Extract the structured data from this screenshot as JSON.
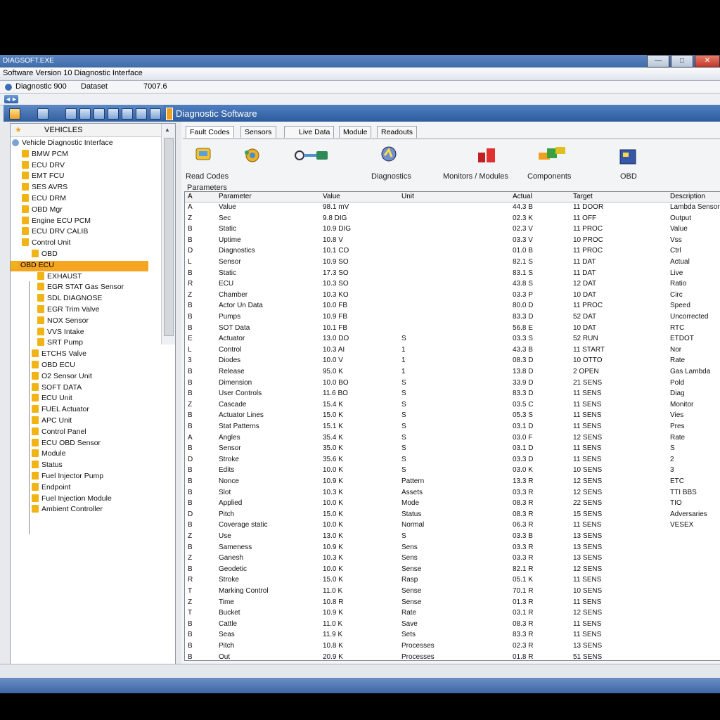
{
  "window": {
    "title": "DIAGSOFT.EXE",
    "window_buttons": [
      "—",
      "□",
      "✕"
    ]
  },
  "menubar": {
    "title": "Software Version 10 Diagnostic Interface",
    "items": [
      "Diagnostic 900",
      "Dataset",
      "7007.6"
    ]
  },
  "header": {
    "title": "Diagnostic Software"
  },
  "left_panel": {
    "header_label": "VEHICLES",
    "tree": [
      "Vehicle Diagnostic Interface",
      "BMW PCM",
      "ECU DRV",
      "EMT FCU",
      "SES AVRS",
      "ECU DRM",
      "OBD Mgr",
      "Engine ECU PCM",
      "ECU DRV CALIB",
      "Control Unit",
      "OBD",
      "OBD ECU",
      "EXHAUST",
      "EGR STAT Gas Sensor",
      "SDL DIAGNOSE",
      "EGR Trim Valve",
      "NOX Sensor",
      "VVS Intake",
      "SRT Pump",
      "ETCHS Valve",
      "OBD ECU",
      "O2 Sensor Unit",
      "SOFT DATA",
      "ECU Unit",
      "FUEL Actuator",
      "APC Unit",
      "Control Panel",
      "ECU OBD Sensor",
      "Module",
      "Status",
      "Fuel Injector Pump",
      "Endpoint",
      "Fuel Injection Module",
      "Ambient Controller"
    ]
  },
  "right_panel": {
    "tabs": [
      "Fault Codes",
      "Sensors",
      "Live Data",
      "Module",
      "Readouts"
    ],
    "tools": [
      {
        "icon": "scan-tool-icon",
        "label": "Read Codes"
      },
      {
        "icon": "gear-tool-icon",
        "label": ""
      },
      {
        "icon": "connector-tool-icon",
        "label": ""
      },
      {
        "icon": "diagnostics-tool-icon",
        "label": "Diagnostics"
      },
      {
        "icon": "chart-tool-icon",
        "label": "Monitors / Modules"
      },
      {
        "icon": "parts-tool-icon",
        "label": "Components"
      },
      {
        "icon": "obd-tool-icon",
        "label": "OBD"
      }
    ],
    "parameters_label": "Parameters",
    "columns": [
      "A",
      "Parameter",
      "Value",
      "Unit",
      "Actual",
      "Target",
      "Description"
    ],
    "rows": [
      [
        "A",
        "Value",
        "98.1 mV",
        "",
        "44.3 B",
        "11 DOOR",
        "Lambda Sensor"
      ],
      [
        "Z",
        "Sec",
        "9.8 DIG",
        "",
        "02.3 K",
        "11 OFF",
        "Output"
      ],
      [
        "B",
        "Static",
        "10.9 DIG",
        "",
        "02.3 V",
        "11 PROC",
        "Value"
      ],
      [
        "B",
        "Uptime",
        "10.8 V",
        "",
        "03.3 V",
        "10 PROC",
        "Vss"
      ],
      [
        "D",
        "Diagnostics",
        "10.1 CO",
        "",
        "01.0 B",
        "11 PROC",
        "Ctrl"
      ],
      [
        "L",
        "Sensor",
        "10.9 SO",
        "",
        "82.1 S",
        "11 DAT",
        "Actual"
      ],
      [
        "B",
        "Static",
        "17.3 SO",
        "",
        "83.1 S",
        "11 DAT",
        "Live"
      ],
      [
        "R",
        "ECU",
        "10.3 SO",
        "",
        "43.8 S",
        "12 DAT",
        "Ratio"
      ],
      [
        "Z",
        "Chamber",
        "10.3 KO",
        "",
        "03.3 P",
        "10 DAT",
        "Circ"
      ],
      [
        "B",
        "Actor Un Data",
        "10.0 FB",
        "",
        "80.0 D",
        "11 PROC",
        "Speed"
      ],
      [
        "B",
        "Pumps",
        "10.9 FB",
        "",
        "83.3 D",
        "52 DAT",
        "Uncorrected"
      ],
      [
        "B",
        "SOT Data",
        "10.1 FB",
        "",
        "56.8 E",
        "10 DAT",
        "RTC"
      ],
      [
        "E",
        "Actuator",
        "13.0 DO",
        "S",
        "03.3 S",
        "52 RUN",
        "ETDOT"
      ],
      [
        "L",
        "Control",
        "10.3 AI",
        "1",
        "43.3 B",
        "11 START",
        "Nor"
      ],
      [
        "3",
        "Diodes",
        "10.0 V",
        "1",
        "08.3 D",
        "10 OTTO",
        "Rate"
      ],
      [
        "B",
        "Release",
        "95.0 K",
        "1",
        "13.8 D",
        "2 OPEN",
        "Gas Lambda"
      ],
      [
        "B",
        "Dimension",
        "10.0 BO",
        "S",
        "33.9 D",
        "21 SENS",
        "Pold"
      ],
      [
        "B",
        "User Controls",
        "11.6 BO",
        "S",
        "83.3 D",
        "11 SENS",
        "Diag"
      ],
      [
        "Z",
        "Cascade",
        "15.4 K",
        "S",
        "03.5 C",
        "11 SENS",
        "Monitor"
      ],
      [
        "B",
        "Actuator Lines",
        "15.0 K",
        "S",
        "05.3 S",
        "11 SENS",
        "Vies"
      ],
      [
        "B",
        "Stat Patterns",
        "15.1 K",
        "S",
        "03.1 D",
        "11 SENS",
        "Pres"
      ],
      [
        "A",
        "Angles",
        "35.4 K",
        "S",
        "03.0 F",
        "12 SENS",
        "Rate"
      ],
      [
        "B",
        "Sensor",
        "35.0 K",
        "S",
        "03.1 D",
        "11 SENS",
        "S"
      ],
      [
        "D",
        "Stroke",
        "35.6 K",
        "S",
        "03.3 D",
        "11 SENS",
        "2"
      ],
      [
        "B",
        "Edits",
        "10.0 K",
        "S",
        "03.0 K",
        "10 SENS",
        "3"
      ],
      [
        "B",
        "Nonce",
        "10.9 K",
        "Pattern",
        "13.3 R",
        "12 SENS",
        "ETC"
      ],
      [
        "B",
        "Slot",
        "10.3 K",
        "Assets",
        "03.3 R",
        "12 SENS",
        "TTI BBS"
      ],
      [
        "B",
        "Applied",
        "10.0 K",
        "Mode",
        "08.3 R",
        "22 SENS",
        "TIO"
      ],
      [
        "D",
        "Pitch",
        "15.0 K",
        "Status",
        "08.3 R",
        "15 SENS",
        "Adversaries"
      ],
      [
        "B",
        "Coverage static",
        "10.0 K",
        "Normal",
        "06.3 R",
        "11 SENS",
        "VESEX"
      ],
      [
        "Z",
        "Use",
        "13.0 K",
        "S",
        "03.3 B",
        "13 SENS",
        ""
      ],
      [
        "B",
        "Sameness",
        "10.9 K",
        "Sens",
        "03.3 R",
        "13 SENS",
        ""
      ],
      [
        "Z",
        "Ganesh",
        "10.3 K",
        "Sens",
        "03.3 R",
        "13 SENS",
        ""
      ],
      [
        "B",
        "Geodetic",
        "10.0 K",
        "Sense",
        "82.1 R",
        "12 SENS",
        ""
      ],
      [
        "R",
        "Stroke",
        "15.0 K",
        "Rasp",
        "05.1 K",
        "11 SENS",
        ""
      ],
      [
        "T",
        "Marking Control",
        "11.0 K",
        "Sense",
        "70.1 R",
        "10 SENS",
        ""
      ],
      [
        "Z",
        "Time",
        "10.8 R",
        "Sense",
        "01.3 R",
        "11 SENS",
        ""
      ],
      [
        "T",
        "Bucket",
        "10.9 K",
        "Rate",
        "03.1 R",
        "12 SENS",
        ""
      ],
      [
        "B",
        "Cattle",
        "11.0 K",
        "Save",
        "08.3 R",
        "11 SENS",
        ""
      ],
      [
        "B",
        "Seas",
        "11.9 K",
        "Sets",
        "83.3 R",
        "11 SENS",
        ""
      ],
      [
        "B",
        "Pitch",
        "10.8 K",
        "Processes",
        "02.3 R",
        "13 SENS",
        ""
      ],
      [
        "B",
        "Out",
        "20.9 K",
        "Processes",
        "01.8 R",
        "51 SENS",
        ""
      ]
    ]
  }
}
